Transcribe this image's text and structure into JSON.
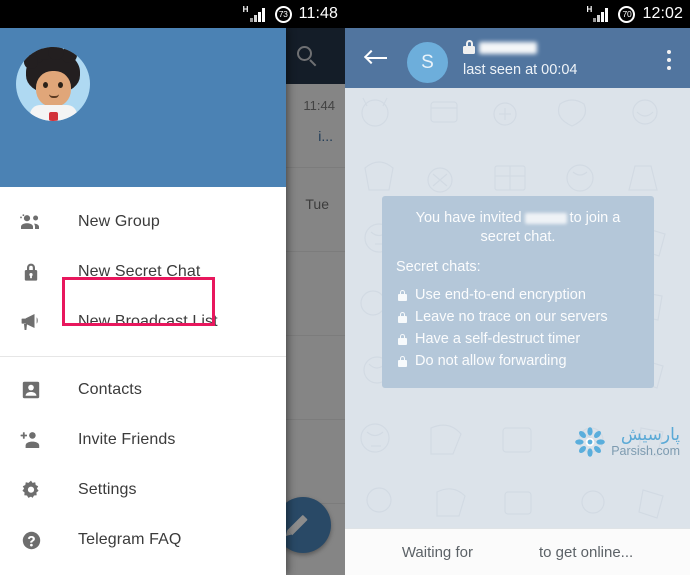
{
  "status_bar_left": {
    "network_label": "H",
    "battery": "73",
    "time": "11:48"
  },
  "status_bar_right": {
    "network_label": "H",
    "battery": "70",
    "time": "12:02"
  },
  "chat_list": {
    "search_icon": "search-icon",
    "rows": [
      {
        "time": "11:44",
        "snippet": "i...",
        "day": ""
      },
      {
        "time": "",
        "snippet": "",
        "day": "Tue"
      }
    ],
    "fab_icon": "pencil-icon"
  },
  "drawer": {
    "avatar_icon": "user-avatar",
    "menu_group_1": [
      {
        "icon": "group-icon",
        "label": "New Group"
      },
      {
        "icon": "lock-icon",
        "label": "New Secret Chat"
      },
      {
        "icon": "megaphone-icon",
        "label": "New Broadcast List"
      }
    ],
    "menu_group_2": [
      {
        "icon": "contact-card-icon",
        "label": "Contacts"
      },
      {
        "icon": "person-add-icon",
        "label": "Invite Friends"
      },
      {
        "icon": "gear-icon",
        "label": "Settings"
      },
      {
        "icon": "question-circle-icon",
        "label": "Telegram FAQ"
      }
    ],
    "highlight": {
      "target_label": "New Secret Chat",
      "color": "#E8175D"
    }
  },
  "chat": {
    "back_icon": "back-arrow-icon",
    "avatar_initial": "S",
    "lock_icon": "lock-icon",
    "contact_name_redacted": true,
    "status": "last seen at 00:04",
    "overflow_icon": "three-dot-menu-icon",
    "bubble": {
      "intro_before": "You have invited",
      "intro_after": "to join a secret chat.",
      "subtitle": "Secret chats:",
      "items": [
        "Use end-to-end encryption",
        "Leave no trace on our servers",
        "Have a self-destruct timer",
        "Do not allow forwarding"
      ]
    },
    "watermark": {
      "farsi": "پارسیش",
      "latin": "Parsish.com"
    },
    "footer_before": "Waiting for",
    "footer_after": "to get online..."
  },
  "colors": {
    "drawer_header": "#4B82B4",
    "chat_toolbar": "#51759F",
    "chat_list_toolbar": "#2A3E55",
    "bubble": "#B4C7D9",
    "wallpaper": "#DCE3EA",
    "highlight": "#E8175D"
  }
}
